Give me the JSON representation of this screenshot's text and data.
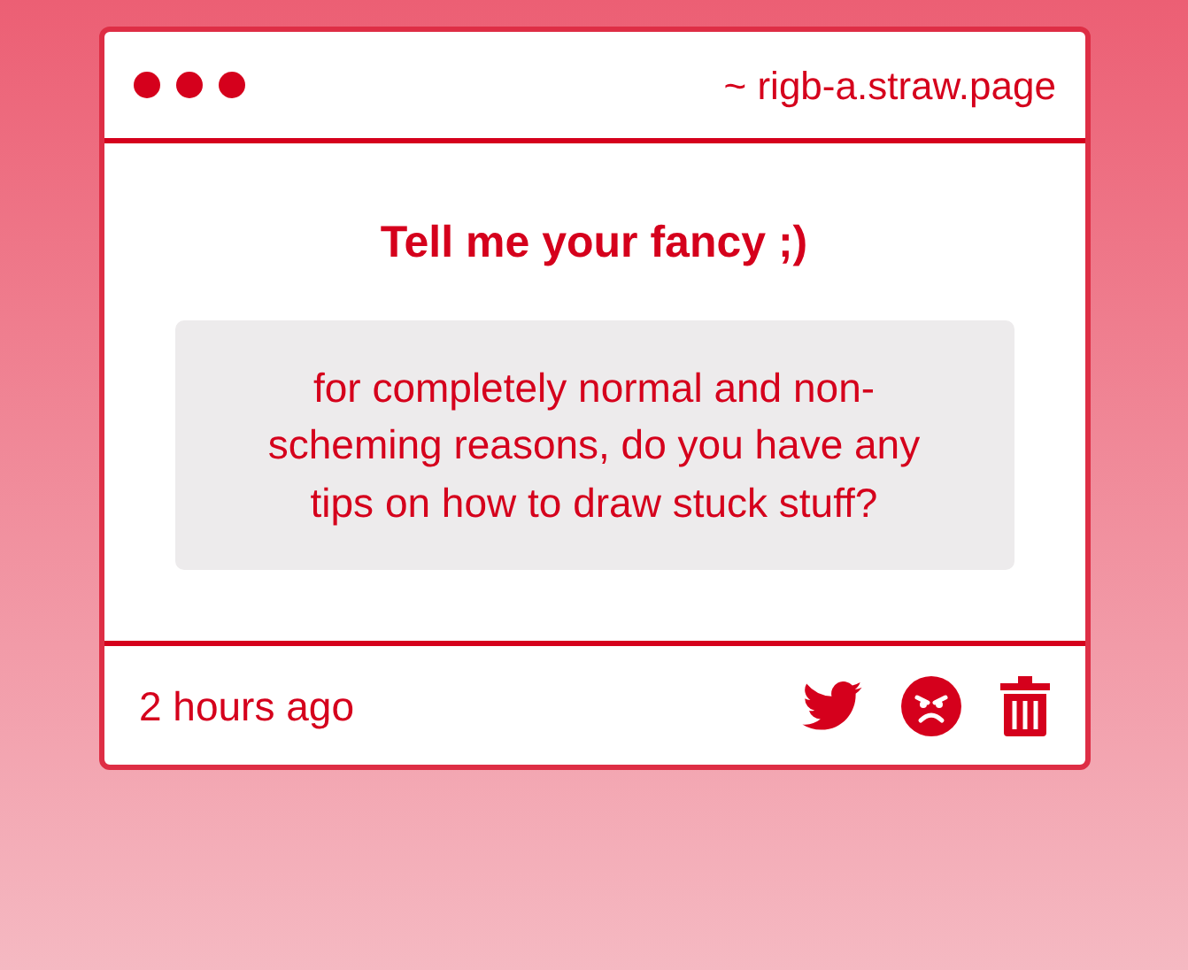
{
  "window": {
    "address": "~ rigb-a.straw.page"
  },
  "card": {
    "title": "Tell me your fancy ;)",
    "message": "for completely normal and non-scheming reasons, do you have any tips on how to draw stuck stuff?"
  },
  "footer": {
    "time": "2 hours ago"
  }
}
